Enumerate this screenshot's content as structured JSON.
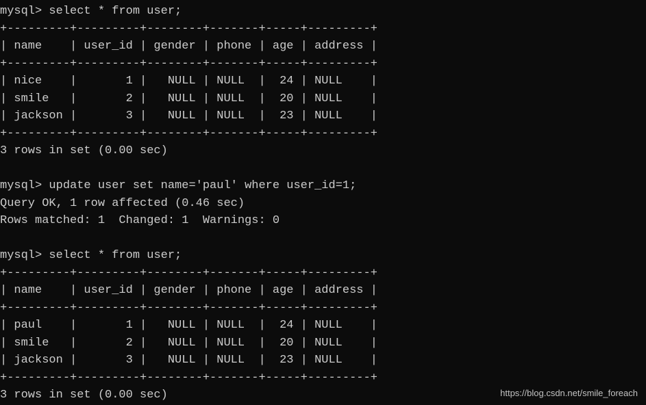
{
  "session1": {
    "prompt": "mysql>",
    "query": "select * from user;",
    "table": {
      "columns": [
        "name",
        "user_id",
        "gender",
        "phone",
        "age",
        "address"
      ],
      "rows": [
        {
          "name": "nice",
          "user_id": "1",
          "gender": "NULL",
          "phone": "NULL",
          "age": "24",
          "address": "NULL"
        },
        {
          "name": "smile",
          "user_id": "2",
          "gender": "NULL",
          "phone": "NULL",
          "age": "20",
          "address": "NULL"
        },
        {
          "name": "jackson",
          "user_id": "3",
          "gender": "NULL",
          "phone": "NULL",
          "age": "23",
          "address": "NULL"
        }
      ]
    },
    "result": "3 rows in set (0.00 sec)"
  },
  "update": {
    "prompt": "mysql>",
    "query": "update user set name='paul' where user_id=1;",
    "result1": "Query OK, 1 row affected (0.46 sec)",
    "result2": "Rows matched: 1  Changed: 1  Warnings: 0"
  },
  "session2": {
    "prompt": "mysql>",
    "query": "select * from user;",
    "table": {
      "columns": [
        "name",
        "user_id",
        "gender",
        "phone",
        "age",
        "address"
      ],
      "rows": [
        {
          "name": "paul",
          "user_id": "1",
          "gender": "NULL",
          "phone": "NULL",
          "age": "24",
          "address": "NULL"
        },
        {
          "name": "smile",
          "user_id": "2",
          "gender": "NULL",
          "phone": "NULL",
          "age": "20",
          "address": "NULL"
        },
        {
          "name": "jackson",
          "user_id": "3",
          "gender": "NULL",
          "phone": "NULL",
          "age": "23",
          "address": "NULL"
        }
      ]
    },
    "result": "3 rows in set (0.00 sec)"
  },
  "watermark": "https://blog.csdn.net/smile_foreach",
  "table_border": {
    "sep": "+---------+---------+--------+-------+-----+---------+",
    "header": "| name    | user_id | gender | phone | age | address |"
  }
}
